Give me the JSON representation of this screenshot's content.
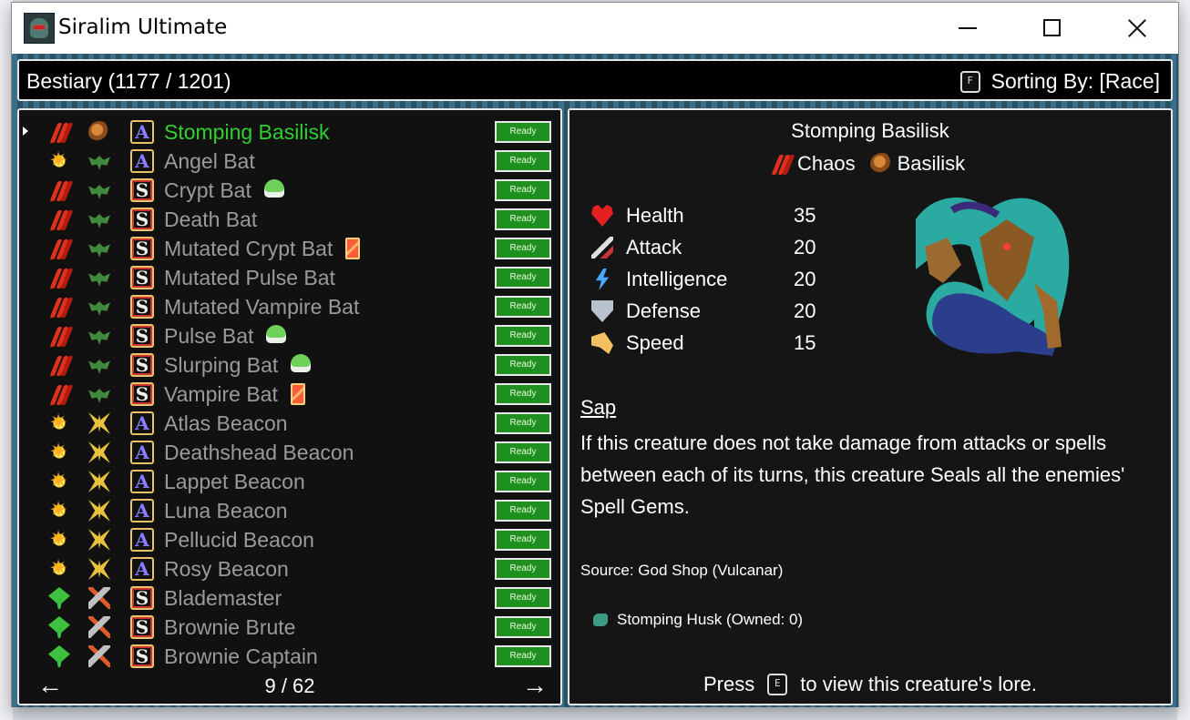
{
  "window": {
    "title": "Siralim Ultimate"
  },
  "header": {
    "title": "Bestiary (1177 / 1201)",
    "sort_key": "F",
    "sort_label": "Sorting By: [Race]"
  },
  "list": {
    "ready_label": "Ready",
    "items": [
      {
        "name": "Stomping Basilisk",
        "class": "chaos",
        "race": "basilisk",
        "rank": "A",
        "badge": "",
        "selected": true
      },
      {
        "name": "Angel Bat",
        "class": "sun",
        "race": "bat",
        "rank": "A",
        "badge": ""
      },
      {
        "name": "Crypt Bat",
        "class": "chaos",
        "race": "bat",
        "rank": "S",
        "badge": "slime"
      },
      {
        "name": "Death Bat",
        "class": "chaos",
        "race": "bat",
        "rank": "S",
        "badge": ""
      },
      {
        "name": "Mutated Crypt Bat",
        "class": "chaos",
        "race": "bat",
        "rank": "S",
        "badge": "card"
      },
      {
        "name": "Mutated Pulse Bat",
        "class": "chaos",
        "race": "bat",
        "rank": "S",
        "badge": ""
      },
      {
        "name": "Mutated Vampire Bat",
        "class": "chaos",
        "race": "bat",
        "rank": "S",
        "badge": ""
      },
      {
        "name": "Pulse Bat",
        "class": "chaos",
        "race": "bat",
        "rank": "S",
        "badge": "slime"
      },
      {
        "name": "Slurping Bat",
        "class": "chaos",
        "race": "bat",
        "rank": "S",
        "badge": "slime"
      },
      {
        "name": "Vampire Bat",
        "class": "chaos",
        "race": "bat",
        "rank": "S",
        "badge": "card"
      },
      {
        "name": "Atlas Beacon",
        "class": "sun",
        "race": "beacon",
        "rank": "A",
        "badge": ""
      },
      {
        "name": "Deathshead Beacon",
        "class": "sun",
        "race": "beacon",
        "rank": "A",
        "badge": ""
      },
      {
        "name": "Lappet Beacon",
        "class": "sun",
        "race": "beacon",
        "rank": "A",
        "badge": ""
      },
      {
        "name": "Luna Beacon",
        "class": "sun",
        "race": "beacon",
        "rank": "A",
        "badge": ""
      },
      {
        "name": "Pellucid Beacon",
        "class": "sun",
        "race": "beacon",
        "rank": "A",
        "badge": ""
      },
      {
        "name": "Rosy Beacon",
        "class": "sun",
        "race": "beacon",
        "rank": "A",
        "badge": ""
      },
      {
        "name": "Blademaster",
        "class": "leaf",
        "race": "brownie",
        "rank": "S",
        "badge": ""
      },
      {
        "name": "Brownie Brute",
        "class": "leaf",
        "race": "brownie",
        "rank": "S",
        "badge": ""
      },
      {
        "name": "Brownie Captain",
        "class": "leaf",
        "race": "brownie",
        "rank": "S",
        "badge": ""
      }
    ],
    "pager": {
      "prev": "←",
      "page": "9 / 62",
      "next": "→"
    }
  },
  "detail": {
    "name": "Stomping Basilisk",
    "class_label": "Chaos",
    "race_label": "Basilisk",
    "stats": [
      {
        "label": "Health",
        "value": "35",
        "icon": "heart-icon"
      },
      {
        "label": "Attack",
        "value": "20",
        "icon": "sword-icon"
      },
      {
        "label": "Intelligence",
        "value": "20",
        "icon": "bolt-icon"
      },
      {
        "label": "Defense",
        "value": "20",
        "icon": "shield-icon"
      },
      {
        "label": "Speed",
        "value": "15",
        "icon": "wing-icon"
      }
    ],
    "ability_name": "Sap",
    "ability_desc": "If this creature does not take damage from attacks or spells between each of its turns, this creature Seals all the enemies' Spell Gems.",
    "source": "Source: God Shop (Vulcanar)",
    "husk": "Stomping Husk (Owned: 0)",
    "press_before": "Press",
    "press_key": "E",
    "press_after": "to view this creature's lore."
  }
}
